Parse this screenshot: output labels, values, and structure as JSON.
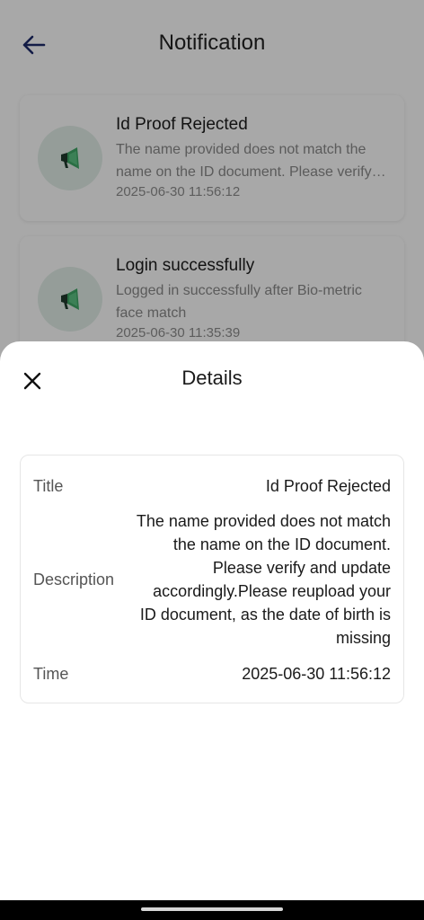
{
  "header": {
    "title": "Notification",
    "back_icon": "arrow-left-icon"
  },
  "notifications": [
    {
      "title": "Id Proof Rejected",
      "description": "The name provided does not match the name on the ID document. Please verify and update accordingly.Please reupload your ID document, as the date of birth is missing",
      "time": "2025-06-30 11:56:12",
      "icon": "megaphone-icon"
    },
    {
      "title": "Login successfully",
      "description": "Logged in successfully after Bio-metric face match",
      "time": "2025-06-30 11:35:39",
      "icon": "megaphone-icon"
    }
  ],
  "details_sheet": {
    "title": "Details",
    "close_icon": "close-icon",
    "rows": {
      "title": {
        "label": "Title",
        "value": "Id Proof Rejected"
      },
      "description": {
        "label": "Description",
        "value": "The name provided does not match the name on the ID document. Please verify and update accordingly.Please reupload your ID document, as the date of birth is missing"
      },
      "time": {
        "label": "Time",
        "value": "2025-06-30 11:56:12"
      }
    }
  },
  "colors": {
    "icon_green": "#3fa766",
    "icon_dark": "#1f3b2c",
    "icon_bg": "#e3efe9",
    "scrim": "rgba(0,0,0,0.34)"
  }
}
